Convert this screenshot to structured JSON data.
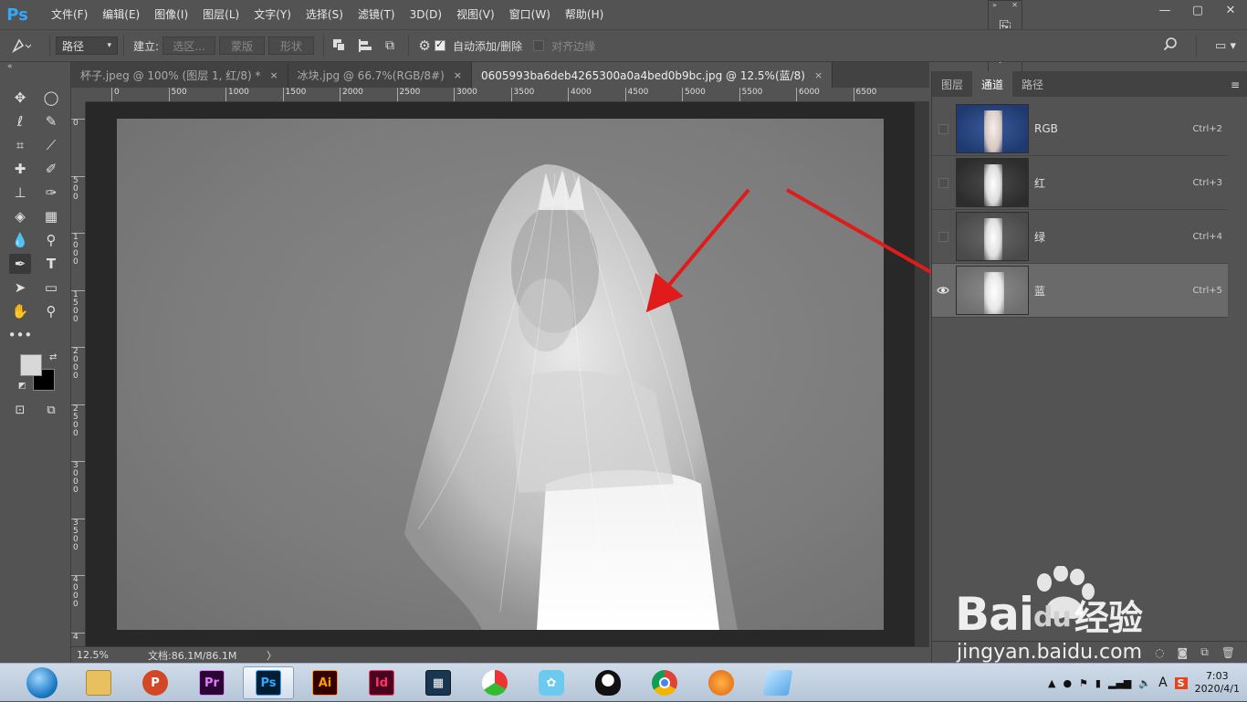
{
  "app": {
    "logo": "Ps"
  },
  "menu": [
    "文件(F)",
    "编辑(E)",
    "图像(I)",
    "图层(L)",
    "文字(Y)",
    "选择(S)",
    "滤镜(T)",
    "3D(D)",
    "视图(V)",
    "窗口(W)",
    "帮助(H)"
  ],
  "window_controls": {
    "minimize": "—",
    "maximize": "▢",
    "close": "✕"
  },
  "options": {
    "mode_select": "路径",
    "make_label": "建立:",
    "selection_btn": "选区...",
    "mask_btn": "蒙版",
    "shape_btn": "形状",
    "auto_add_label": "自动添加/删除",
    "auto_add_checked": true,
    "align_edges_label": "对齐边缘",
    "align_edges_checked": false
  },
  "tabs": [
    {
      "label": "杯子.jpeg @ 100% (图层 1, 红/8) *",
      "close": "×",
      "active": false
    },
    {
      "label": "冰块.jpg @ 66.7%(RGB/8#)",
      "close": "×",
      "active": false
    },
    {
      "label": "0605993ba6deb4265300a0a4bed0b9bc.jpg @ 12.5%(蓝/8)",
      "close": "×",
      "active": true
    }
  ],
  "ruler_top": [
    "0",
    "500",
    "1000",
    "1500",
    "2000",
    "2500",
    "3000",
    "3500",
    "4000",
    "4500",
    "5000",
    "5500",
    "6000",
    "6500"
  ],
  "ruler_left": [
    "0",
    "5\n0\n0",
    "1\n0\n0\n0",
    "1\n5\n0\n0",
    "2\n0\n0\n0",
    "2\n5\n0\n0",
    "3\n0\n0\n0",
    "3\n5\n0\n0",
    "4\n0\n0\n0",
    "4"
  ],
  "status": {
    "zoom": "12.5%",
    "doc_info": "文档:86.1M/86.1M",
    "arrow": "〉"
  },
  "panel": {
    "tabs": [
      {
        "label": "图层",
        "active": false
      },
      {
        "label": "通道",
        "active": true
      },
      {
        "label": "路径",
        "active": false
      }
    ],
    "menu_icon": "≡",
    "channels": [
      {
        "name": "RGB",
        "shortcut": "Ctrl+2",
        "visible": false,
        "selected": false
      },
      {
        "name": "红",
        "shortcut": "Ctrl+3",
        "visible": false,
        "selected": false
      },
      {
        "name": "绿",
        "shortcut": "Ctrl+4",
        "visible": false,
        "selected": false
      },
      {
        "name": "蓝",
        "shortcut": "Ctrl+5",
        "visible": true,
        "selected": true
      }
    ],
    "bottom_icons": [
      "dotted-circle-icon",
      "mask-icon",
      "new-channel-icon",
      "trash-icon"
    ]
  },
  "watermark": {
    "brand": "Bai",
    "brand2": "du",
    "suffix": "经验",
    "url": "jingyan.baidu.com"
  },
  "taskbar": {
    "apps": [
      {
        "name": "windows-start",
        "label": ""
      },
      {
        "name": "file-explorer",
        "label": ""
      },
      {
        "name": "powerpoint",
        "label": "P"
      },
      {
        "name": "premiere",
        "label": "Pr"
      },
      {
        "name": "photoshop",
        "label": "Ps"
      },
      {
        "name": "illustrator",
        "label": "Ai"
      },
      {
        "name": "indesign",
        "label": "Id"
      },
      {
        "name": "video-editor",
        "label": ""
      },
      {
        "name": "colorful-app",
        "label": ""
      },
      {
        "name": "bird-app",
        "label": ""
      },
      {
        "name": "qq",
        "label": ""
      },
      {
        "name": "chrome",
        "label": ""
      },
      {
        "name": "fox-app",
        "label": ""
      },
      {
        "name": "notepad-app",
        "label": ""
      }
    ],
    "clock_time": "7:03",
    "clock_date": "2020/4/1",
    "tray_text": "A"
  },
  "colors": {
    "accent": "#31a8ff",
    "panel_bg": "#535353",
    "canvas_bg": "#282828",
    "arrow_red": "#e01b1b"
  }
}
